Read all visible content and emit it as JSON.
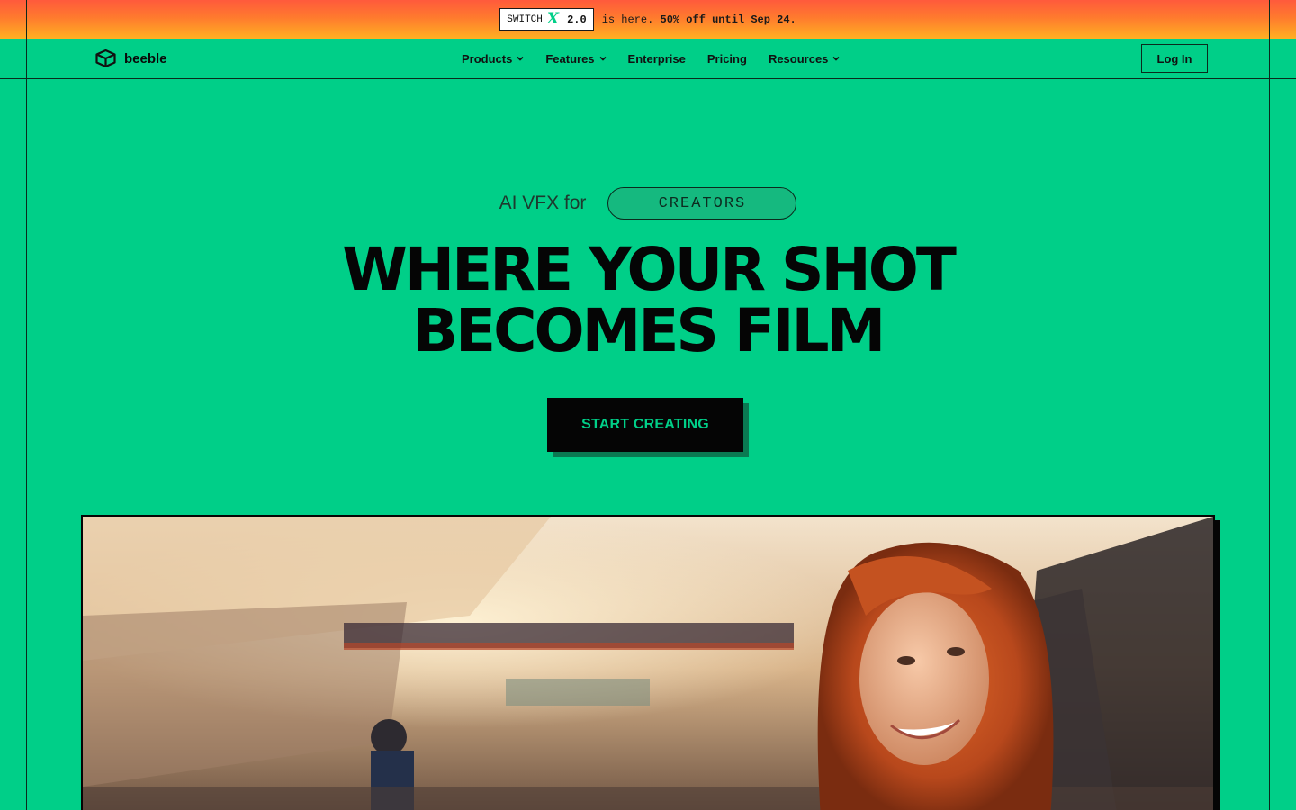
{
  "promo": {
    "badge_word": "SWITCH",
    "badge_mark": "X",
    "badge_version": "2.0",
    "text_prefix": "is here.",
    "text_offer": "50% off until Sep 24."
  },
  "nav": {
    "brand": "beeble",
    "menu": [
      {
        "label": "Products",
        "has_dropdown": true
      },
      {
        "label": "Features",
        "has_dropdown": true
      },
      {
        "label": "Enterprise",
        "has_dropdown": false
      },
      {
        "label": "Pricing",
        "has_dropdown": false
      },
      {
        "label": "Resources",
        "has_dropdown": true
      }
    ],
    "login_label": "Log In"
  },
  "hero": {
    "tagline_prefix": "AI VFX for",
    "tagline_word": "CREATORS",
    "headline_line1": "WHERE YOUR SHOT",
    "headline_line2": "BECOMES FILM",
    "cta_label": "START CREATING"
  },
  "colors": {
    "brand_green": "#00CF88",
    "ink": "#050505",
    "banner_top": "#ff5a3c",
    "banner_bottom": "#ffb022"
  }
}
